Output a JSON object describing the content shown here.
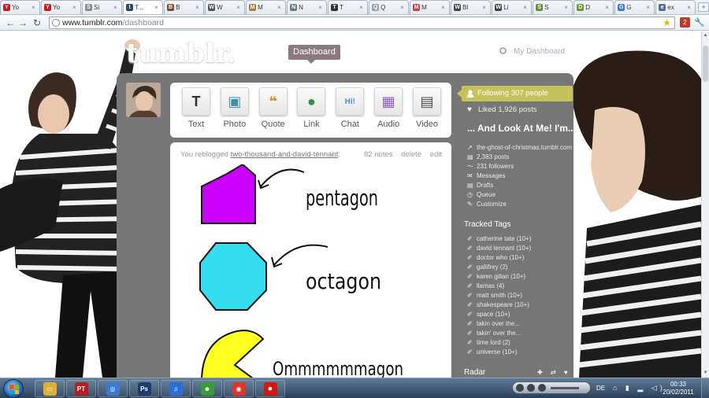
{
  "browser": {
    "tabs": [
      {
        "label": "Yo",
        "color": "#cc181e",
        "glyph": "Y"
      },
      {
        "label": "Yo",
        "color": "#cc181e",
        "glyph": "Y"
      },
      {
        "label": "Si",
        "color": "#8a8a8a",
        "glyph": "S"
      },
      {
        "label": "T...",
        "color": "#2c4762",
        "glyph": "t",
        "active": true
      },
      {
        "label": "B",
        "color": "#7a4f2b",
        "glyph": "B"
      },
      {
        "label": "W",
        "color": "#555555",
        "glyph": "W"
      },
      {
        "label": "M",
        "color": "#b07d3a",
        "glyph": "M"
      },
      {
        "label": "N",
        "color": "#6c7a89",
        "glyph": "N"
      },
      {
        "label": "T",
        "color": "#333333",
        "glyph": "T"
      },
      {
        "label": "Q",
        "color": "#9aa3ad",
        "glyph": "Q"
      },
      {
        "label": "M",
        "color": "#d04040",
        "glyph": "M"
      },
      {
        "label": "Bl",
        "color": "#444444",
        "glyph": "W"
      },
      {
        "label": "Li",
        "color": "#444444",
        "glyph": "W"
      },
      {
        "label": "S",
        "color": "#6b8e3a",
        "glyph": "S"
      },
      {
        "label": "D",
        "color": "#6a9a2a",
        "glyph": "D"
      },
      {
        "label": "G",
        "color": "#3a7ad1",
        "glyph": "G"
      },
      {
        "label": "ex",
        "color": "#4e6e9a",
        "glyph": "e"
      }
    ],
    "url_domain": "www.tumblr.com",
    "url_path": "/dashboard",
    "ext_badge": "2",
    "back_glyph": "←",
    "forward_glyph": "→",
    "reload_glyph": "↻",
    "star_glyph": "★",
    "wrench_glyph": "🔧"
  },
  "header": {
    "logo": "tumblr.",
    "dashboard_label": "Dashboard",
    "search_placeholder": "My Dashboard"
  },
  "post_types": [
    {
      "label": "Text",
      "icon": "text-icon",
      "glyph": "T",
      "color": "#333333"
    },
    {
      "label": "Photo",
      "icon": "photo-icon",
      "glyph": "▣",
      "color": "#3b8fb0"
    },
    {
      "label": "Quote",
      "icon": "quote-icon",
      "glyph": "❝",
      "color": "#e08a2d"
    },
    {
      "label": "Link",
      "icon": "link-icon",
      "glyph": "●",
      "color": "#3a8f3a"
    },
    {
      "label": "Chat",
      "icon": "chat-icon",
      "glyph": "Hi!",
      "color": "#4a90d9"
    },
    {
      "label": "Audio",
      "icon": "audio-icon",
      "glyph": "▦",
      "color": "#8e5fbf"
    },
    {
      "label": "Video",
      "icon": "video-icon",
      "glyph": "▤",
      "color": "#4a4a4a"
    }
  ],
  "post": {
    "reblog_prefix": "You reblogged",
    "reblog_user": "two-thousand-and-david-tennant",
    "reblog_suffix": ":",
    "notes": "82 notes",
    "delete": "delete",
    "edit": "edit",
    "shapes": [
      {
        "label": "pentagon",
        "color": "#cc00ff"
      },
      {
        "label": "octagon",
        "color": "#33ddee"
      },
      {
        "label": "Ommmmmmagon",
        "color": "#ffff22"
      }
    ]
  },
  "sidebar": {
    "following": "Following 307 people",
    "liked": "Liked 1,926 posts",
    "blog_name": "... And Look At Me! I'm...",
    "blog_links": [
      {
        "label": "the-ghost-of-christmas.tumblr.com",
        "glyph": "↗"
      },
      {
        "label": "2,383 posts",
        "glyph": "▤"
      },
      {
        "label": "231 followers",
        "glyph": "〜"
      },
      {
        "label": "Messages",
        "glyph": "✉"
      },
      {
        "label": "Drafts",
        "glyph": "▤"
      },
      {
        "label": "Queue",
        "glyph": "◷"
      },
      {
        "label": "Customize",
        "glyph": "✎"
      }
    ],
    "tracked_tags_title": "Tracked Tags",
    "tracked_tags": [
      "catherine tate (10+)",
      "david tennant (10+)",
      "doctor who (10+)",
      "gallifrey (2)",
      "karen gillan (10+)",
      "llamas (4)",
      "matt smith (10+)",
      "shakespeare (10+)",
      "space (10+)",
      "takin over the...",
      "takin' over the...",
      "time lord (2)",
      "universe (10+)"
    ],
    "tag_glyph": "✐",
    "radar_title": "Radar",
    "radar_icons": "✚ ⇄ ♥"
  },
  "taskbar": {
    "apps": [
      {
        "name": "explorer",
        "color": "#e0b13a",
        "glyph": "▭"
      },
      {
        "name": "pt",
        "color": "#b22222",
        "glyph": "PT"
      },
      {
        "name": "browser-a",
        "color": "#3a7ad1",
        "glyph": "◎"
      },
      {
        "name": "photoshop",
        "color": "#1c3f73",
        "glyph": "Ps"
      },
      {
        "name": "itunes",
        "color": "#2a6fd6",
        "glyph": "♫"
      },
      {
        "name": "msn",
        "color": "#3b9b3b",
        "glyph": "☻"
      },
      {
        "name": "chrome",
        "color": "#d9392c",
        "glyph": "◉"
      },
      {
        "name": "splat",
        "color": "#d01818",
        "glyph": "✸"
      }
    ],
    "language": "DE",
    "tray_icons": "⌂ ▮ ▂ ◁)",
    "time": "00:33",
    "date": "20/02/2011"
  }
}
